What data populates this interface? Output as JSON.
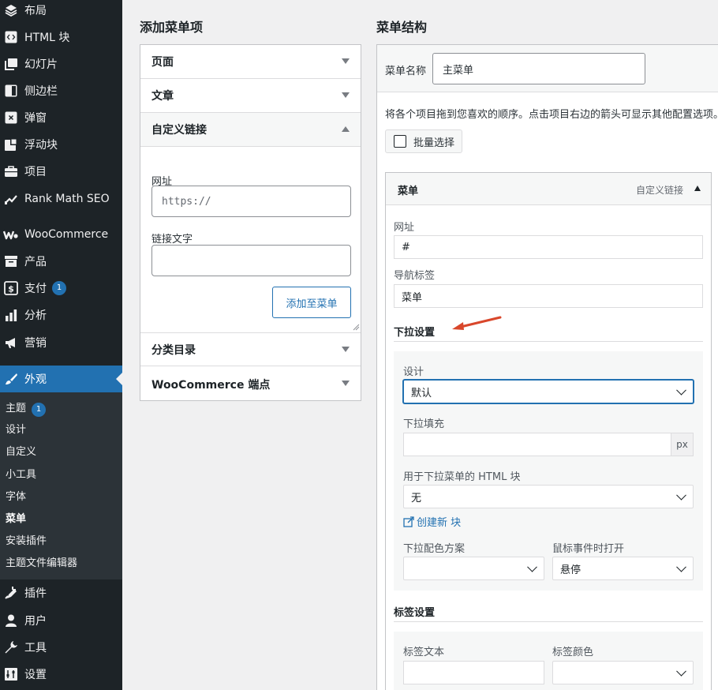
{
  "sidebar": {
    "items": [
      {
        "label": "布局",
        "icon": "layers-icon"
      },
      {
        "label": "HTML 块",
        "icon": "code-block-icon"
      },
      {
        "label": "幻灯片",
        "icon": "slides-icon"
      },
      {
        "label": "侧边栏",
        "icon": "sidebar-icon"
      },
      {
        "label": "弹窗",
        "icon": "popup-icon"
      },
      {
        "label": "浮动块",
        "icon": "floating-block-icon"
      },
      {
        "label": "项目",
        "icon": "portfolio-icon"
      },
      {
        "label": "Rank Math SEO",
        "icon": "rank-math-icon"
      },
      {
        "label": "WooCommerce",
        "icon": "woocommerce-icon"
      },
      {
        "label": "产品",
        "icon": "archive-icon"
      },
      {
        "label": "支付",
        "icon": "payment-icon",
        "badge": "1"
      },
      {
        "label": "分析",
        "icon": "chart-bar-icon"
      },
      {
        "label": "营销",
        "icon": "megaphone-icon"
      },
      {
        "label": "外观",
        "icon": "paintbrush-icon"
      },
      {
        "label": "插件",
        "icon": "plugin-icon"
      },
      {
        "label": "用户",
        "icon": "user-icon"
      },
      {
        "label": "工具",
        "icon": "wrench-icon"
      },
      {
        "label": "设置",
        "icon": "settings-icon"
      }
    ],
    "submenu": [
      {
        "label": "主题",
        "badge": "1"
      },
      {
        "label": "设计"
      },
      {
        "label": "自定义"
      },
      {
        "label": "小工具"
      },
      {
        "label": "字体"
      },
      {
        "label": "菜单"
      },
      {
        "label": "安装插件"
      },
      {
        "label": "主题文件编辑器"
      }
    ]
  },
  "add_items": {
    "title": "添加菜单项",
    "sections": [
      "页面",
      "文章",
      "自定义链接",
      "分类目录",
      "WooCommerce 端点"
    ],
    "custom_link": {
      "url_label": "网址",
      "url_placeholder": "https://",
      "text_label": "链接文字",
      "text_value": "",
      "add_button": "添加至菜单"
    }
  },
  "structure": {
    "title": "菜单结构",
    "name_label": "菜单名称",
    "name_value": "主菜单",
    "hint": "将各个项目拖到您喜欢的顺序。点击项目右边的箭头可显示其他配置选项。",
    "bulk_select": "批量选择",
    "item": {
      "title": "菜单",
      "type": "自定义链接",
      "url_label": "网址",
      "url_value": "#",
      "nav_label_label": "导航标签",
      "nav_label_value": "菜单",
      "dropdown_section": "下拉设置",
      "design_label": "设计",
      "design_value": "默认",
      "padding_label": "下拉填充",
      "padding_value": "",
      "padding_unit": "px",
      "html_block_label": "用于下拉菜单的 HTML 块",
      "html_block_value": "无",
      "create_block_link": "创建新 块",
      "color_scheme_label": "下拉配色方案",
      "color_scheme_value": "",
      "open_on_label": "鼠标事件时打开",
      "open_on_value": "悬停",
      "label_section": "标签设置",
      "label_text_label": "标签文本",
      "label_text_value": "",
      "label_color_label": "标签颜色",
      "label_color_value": ""
    }
  },
  "colors": {
    "accent": "#2271b1",
    "sidebar_bg": "#1d2327",
    "annotation_arrow": "#d9472b"
  }
}
